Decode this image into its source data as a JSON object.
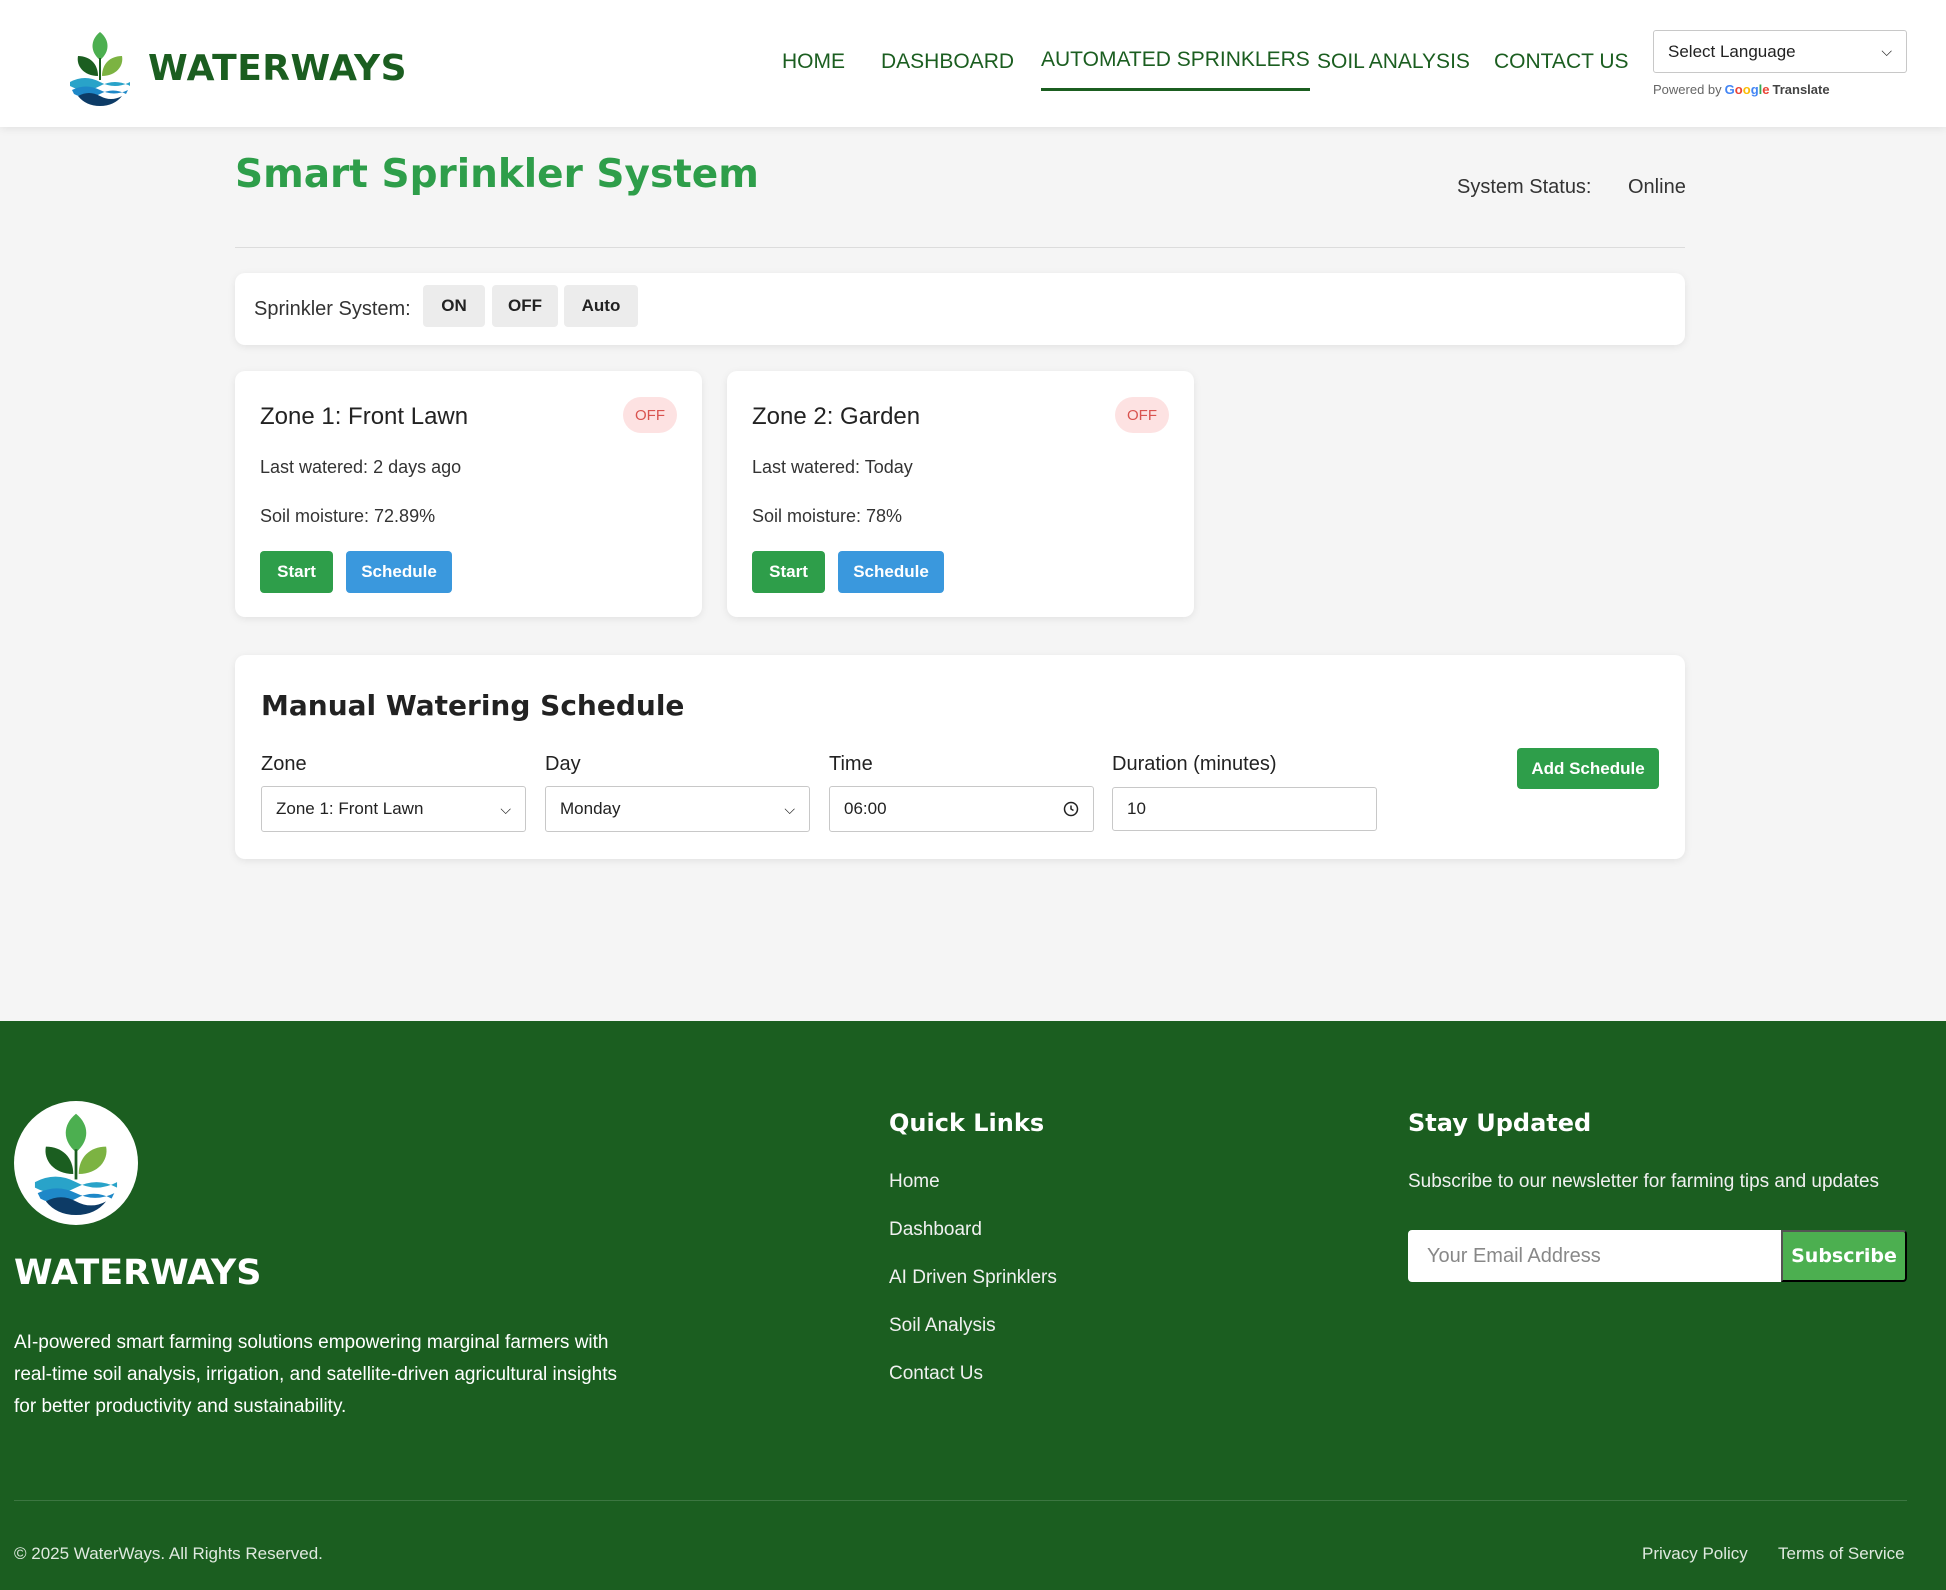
{
  "header": {
    "brand": "WATERWAYS",
    "nav": [
      {
        "label": "HOME"
      },
      {
        "label": "DASHBOARD"
      },
      {
        "label": "AUTOMATED SPRINKLERS",
        "active": true
      },
      {
        "label": "SOIL ANALYSIS"
      },
      {
        "label": "CONTACT US"
      }
    ],
    "language_select": "Select Language",
    "powered_by": "Powered by",
    "google": "Google",
    "translate": "Translate"
  },
  "page": {
    "title": "Smart Sprinkler System",
    "status_label": "System Status:",
    "status_value": "Online"
  },
  "control": {
    "label": "Sprinkler System:",
    "buttons": [
      "ON",
      "OFF",
      "Auto"
    ]
  },
  "zones": [
    {
      "title": "Zone 1: Front Lawn",
      "status": "OFF",
      "last_watered": "Last watered: 2 days ago",
      "moisture": "Soil moisture: 72.89%",
      "start_label": "Start",
      "schedule_label": "Schedule"
    },
    {
      "title": "Zone 2: Garden",
      "status": "OFF",
      "last_watered": "Last watered: Today",
      "moisture": "Soil moisture: 78%",
      "start_label": "Start",
      "schedule_label": "Schedule"
    }
  ],
  "schedule": {
    "title": "Manual Watering Schedule",
    "zone_label": "Zone",
    "zone_value": "Zone 1: Front Lawn",
    "day_label": "Day",
    "day_value": "Monday",
    "time_label": "Time",
    "time_value": "06:00",
    "duration_label": "Duration (minutes)",
    "duration_value": "10",
    "add_label": "Add Schedule"
  },
  "footer": {
    "brand": "WATERWAYS",
    "description": "AI-powered smart farming solutions empowering marginal farmers with real-time soil analysis, irrigation, and satellite-driven agricultural insights for better productivity and sustainability.",
    "quick_links_title": "Quick Links",
    "links": [
      "Home",
      "Dashboard",
      "AI Driven Sprinklers",
      "Soil Analysis",
      "Contact Us"
    ],
    "newsletter_title": "Stay Updated",
    "newsletter_text": "Subscribe to our newsletter for farming tips and updates",
    "email_placeholder": "Your Email Address",
    "subscribe_label": "Subscribe",
    "copyright": "© 2025 WaterWays. All Rights Reserved.",
    "privacy": "Privacy Policy",
    "terms": "Terms of Service"
  },
  "colors": {
    "brand_dark_green": "#1b5e20",
    "accent_green": "#2e9e4a",
    "accent_blue": "#3a98dd",
    "off_badge_bg": "#fde2e2",
    "off_badge_text": "#d9534f"
  }
}
